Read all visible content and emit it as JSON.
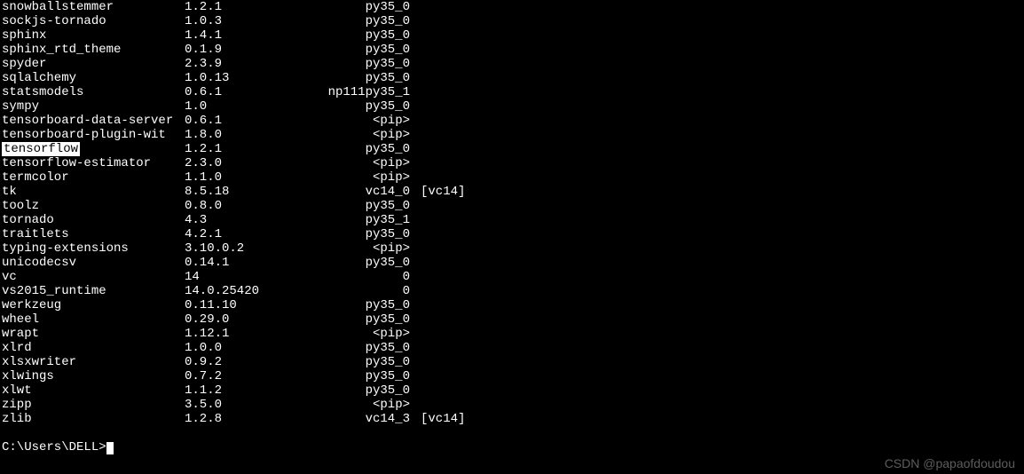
{
  "packages": [
    {
      "name": "snowballstemmer",
      "version": "1.2.1",
      "build": "py35_0",
      "channel": "",
      "highlighted": false
    },
    {
      "name": "sockjs-tornado",
      "version": "1.0.3",
      "build": "py35_0",
      "channel": "",
      "highlighted": false
    },
    {
      "name": "sphinx",
      "version": "1.4.1",
      "build": "py35_0",
      "channel": "",
      "highlighted": false
    },
    {
      "name": "sphinx_rtd_theme",
      "version": "0.1.9",
      "build": "py35_0",
      "channel": "",
      "highlighted": false
    },
    {
      "name": "spyder",
      "version": "2.3.9",
      "build": "py35_0",
      "channel": "",
      "highlighted": false
    },
    {
      "name": "sqlalchemy",
      "version": "1.0.13",
      "build": "py35_0",
      "channel": "",
      "highlighted": false
    },
    {
      "name": "statsmodels",
      "version": "0.6.1",
      "build": "np111py35_1",
      "channel": "",
      "highlighted": false
    },
    {
      "name": "sympy",
      "version": "1.0",
      "build": "py35_0",
      "channel": "",
      "highlighted": false
    },
    {
      "name": "tensorboard-data-server",
      "version": "0.6.1",
      "build": "<pip>",
      "channel": "",
      "highlighted": false
    },
    {
      "name": "tensorboard-plugin-wit",
      "version": "1.8.0",
      "build": "<pip>",
      "channel": "",
      "highlighted": false
    },
    {
      "name": "tensorflow",
      "version": "1.2.1",
      "build": "py35_0",
      "channel": "",
      "highlighted": true
    },
    {
      "name": "tensorflow-estimator",
      "version": "2.3.0",
      "build": "<pip>",
      "channel": "",
      "highlighted": false
    },
    {
      "name": "termcolor",
      "version": "1.1.0",
      "build": "<pip>",
      "channel": "",
      "highlighted": false
    },
    {
      "name": "tk",
      "version": "8.5.18",
      "build": "vc14_0",
      "channel": "[vc14]",
      "highlighted": false
    },
    {
      "name": "toolz",
      "version": "0.8.0",
      "build": "py35_0",
      "channel": "",
      "highlighted": false
    },
    {
      "name": "tornado",
      "version": "4.3",
      "build": "py35_1",
      "channel": "",
      "highlighted": false
    },
    {
      "name": "traitlets",
      "version": "4.2.1",
      "build": "py35_0",
      "channel": "",
      "highlighted": false
    },
    {
      "name": "typing-extensions",
      "version": "3.10.0.2",
      "build": "<pip>",
      "channel": "",
      "highlighted": false
    },
    {
      "name": "unicodecsv",
      "version": "0.14.1",
      "build": "py35_0",
      "channel": "",
      "highlighted": false
    },
    {
      "name": "vc",
      "version": "14",
      "build": "0",
      "channel": "",
      "highlighted": false
    },
    {
      "name": "vs2015_runtime",
      "version": "14.0.25420",
      "build": "0",
      "channel": "",
      "highlighted": false
    },
    {
      "name": "werkzeug",
      "version": "0.11.10",
      "build": "py35_0",
      "channel": "",
      "highlighted": false
    },
    {
      "name": "wheel",
      "version": "0.29.0",
      "build": "py35_0",
      "channel": "",
      "highlighted": false
    },
    {
      "name": "wrapt",
      "version": "1.12.1",
      "build": "<pip>",
      "channel": "",
      "highlighted": false
    },
    {
      "name": "xlrd",
      "version": "1.0.0",
      "build": "py35_0",
      "channel": "",
      "highlighted": false
    },
    {
      "name": "xlsxwriter",
      "version": "0.9.2",
      "build": "py35_0",
      "channel": "",
      "highlighted": false
    },
    {
      "name": "xlwings",
      "version": "0.7.2",
      "build": "py35_0",
      "channel": "",
      "highlighted": false
    },
    {
      "name": "xlwt",
      "version": "1.1.2",
      "build": "py35_0",
      "channel": "",
      "highlighted": false
    },
    {
      "name": "zipp",
      "version": "3.5.0",
      "build": "<pip>",
      "channel": "",
      "highlighted": false
    },
    {
      "name": "zlib",
      "version": "1.2.8",
      "build": "vc14_3",
      "channel": "[vc14]",
      "highlighted": false
    }
  ],
  "prompt": "C:\\Users\\DELL>",
  "watermark": "CSDN @papaofdoudou"
}
